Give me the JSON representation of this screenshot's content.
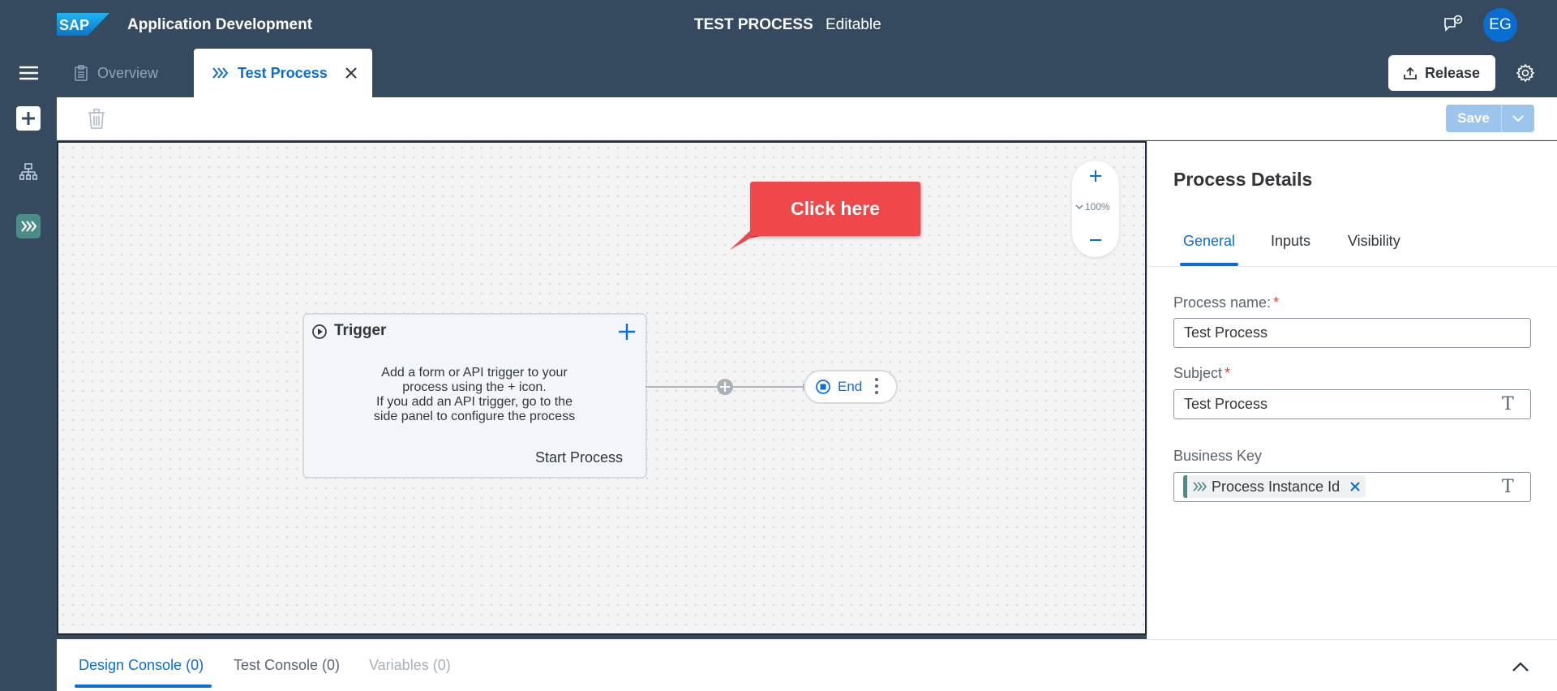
{
  "header": {
    "app_title": "Application Development",
    "doc_title": "TEST PROCESS",
    "doc_status": "Editable",
    "logo_text": "SAP",
    "user_initials": "EG"
  },
  "tabs": {
    "overview": "Overview",
    "active": "Test Process",
    "release": "Release"
  },
  "toolbar": {
    "save": "Save"
  },
  "canvas": {
    "zoom_level": "100%",
    "callout": "Click here",
    "trigger": {
      "title": "Trigger",
      "description_lines": [
        "Add a form or API trigger to your",
        "process using the + icon.",
        "If you add an API trigger, go to the",
        "side panel to configure the process"
      ],
      "subtitle": "Start Process"
    },
    "end_label": "End"
  },
  "panel": {
    "title": "Process Details",
    "tabs": [
      "General",
      "Inputs",
      "Visibility"
    ],
    "process_name_label": "Process name:",
    "process_name_value": "Test Process",
    "subject_label": "Subject",
    "subject_value": "Test Process",
    "business_key_label": "Business Key",
    "business_key_token": "Process Instance Id",
    "required_mark": "*"
  },
  "footer": {
    "tabs": [
      "Design Console (0)",
      "Test Console (0)",
      "Variables (0)"
    ]
  },
  "colors": {
    "shell": "#354a5f",
    "accent": "#0a6ed1",
    "callout": "#f0474b",
    "process_green": "#4b8d86"
  }
}
